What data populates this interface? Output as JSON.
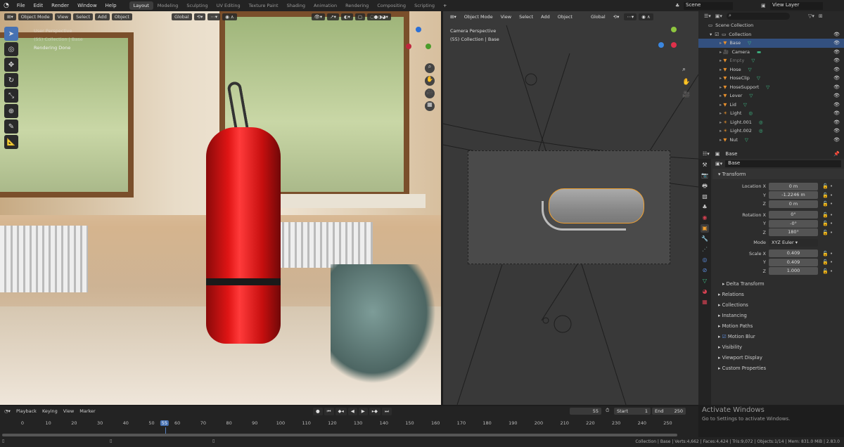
{
  "topbar": {
    "menus": [
      "File",
      "Edit",
      "Render",
      "Window",
      "Help"
    ],
    "workspaces": [
      "Layout",
      "Modeling",
      "Sculpting",
      "UV Editing",
      "Texture Paint",
      "Shading",
      "Animation",
      "Rendering",
      "Compositing",
      "Scripting"
    ],
    "active_workspace": "Layout",
    "add_label": "+",
    "scene": "Scene",
    "view_layer": "View Layer"
  },
  "left_viewport": {
    "mode": "Object Mode",
    "menus": [
      "View",
      "Select",
      "Add",
      "Object"
    ],
    "orientation": "Global",
    "overlay_text": [
      "User Perspective",
      "(55) Collection | Base",
      "Rendering Done"
    ]
  },
  "right_viewport": {
    "mode": "Object Mode",
    "menus": [
      "View",
      "Select",
      "Add",
      "Object"
    ],
    "orientation": "Global",
    "overlay_text": [
      "Camera Perspective",
      "(55) Collection | Base"
    ]
  },
  "outliner": {
    "scene_collection": "Scene Collection",
    "collection": "Collection",
    "items": [
      {
        "name": "Base",
        "selected": true
      },
      {
        "name": "Camera"
      },
      {
        "name": "Empty",
        "dim": true
      },
      {
        "name": "Hose"
      },
      {
        "name": "HoseClip"
      },
      {
        "name": "HoseSupport"
      },
      {
        "name": "Lever"
      },
      {
        "name": "Lid"
      },
      {
        "name": "Light"
      },
      {
        "name": "Light.001"
      },
      {
        "name": "Light.002"
      },
      {
        "name": "Nut"
      }
    ]
  },
  "properties": {
    "object_name": "Base",
    "name_field": "Base",
    "transform_label": "Transform",
    "location": {
      "label": "Location X",
      "x": "0 m",
      "y": "-1.2246 m",
      "z": "0 m"
    },
    "rotation": {
      "label": "Rotation X",
      "x": "0°",
      "y": "-0°",
      "z": "180°"
    },
    "mode_label": "Mode",
    "mode": "XYZ Euler",
    "scale": {
      "label": "Scale X",
      "x": "0.409",
      "y": "0.409",
      "z": "1.000"
    },
    "axis_y": "Y",
    "axis_z": "Z",
    "delta": "Delta Transform",
    "panels": [
      "Relations",
      "Collections",
      "Instancing",
      "Motion Paths",
      "Motion Blur",
      "Visibility",
      "Viewport Display",
      "Custom Properties"
    ]
  },
  "timeline": {
    "menus": [
      "Playback",
      "Keying",
      "View",
      "Marker"
    ],
    "current_frame": "55",
    "start_label": "Start",
    "start": "1",
    "end_label": "End",
    "end": "250",
    "ticks": [
      "0",
      "10",
      "20",
      "30",
      "40",
      "50",
      "55",
      "60",
      "70",
      "80",
      "90",
      "100",
      "110",
      "120",
      "130",
      "140",
      "150",
      "160",
      "170",
      "180",
      "190",
      "200",
      "210",
      "220",
      "230",
      "240",
      "250"
    ]
  },
  "watermark": {
    "title": "Activate Windows",
    "subtitle": "Go to Settings to activate Windows."
  },
  "status": "Collection | Base | Verts:4,662 | Faces:4,424 | Tris:9,072 | Objects:1/14 | Mem: 831.0 MiB | 2.83.0"
}
